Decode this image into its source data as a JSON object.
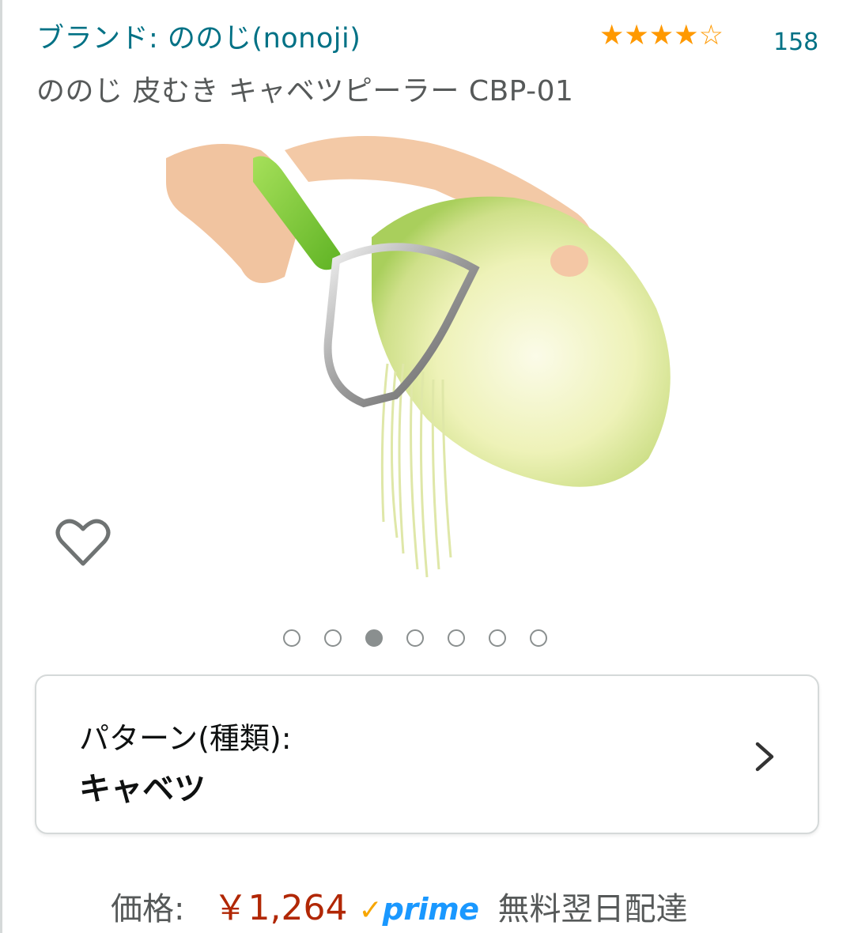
{
  "product": {
    "brand_link": "ブランド: ののじ(nonoji)",
    "rating_count": "158",
    "rating_stars": 4,
    "title": "ののじ 皮むき キャベツピーラー CBP-01"
  },
  "gallery": {
    "image_alt": "キャベツピーラー",
    "dot_count": 7,
    "active_index": 2
  },
  "variation": {
    "label": "パターン(種類):",
    "value": "キャベツ"
  },
  "price": {
    "label": "価格:",
    "value": "￥1,264",
    "prime_check": "✓",
    "prime_text": "prime",
    "delivery": "無料翌日配達"
  },
  "colors": {
    "link": "#007185",
    "star": "#ff9900",
    "price": "#b12704",
    "prime": "#1a98ff"
  }
}
